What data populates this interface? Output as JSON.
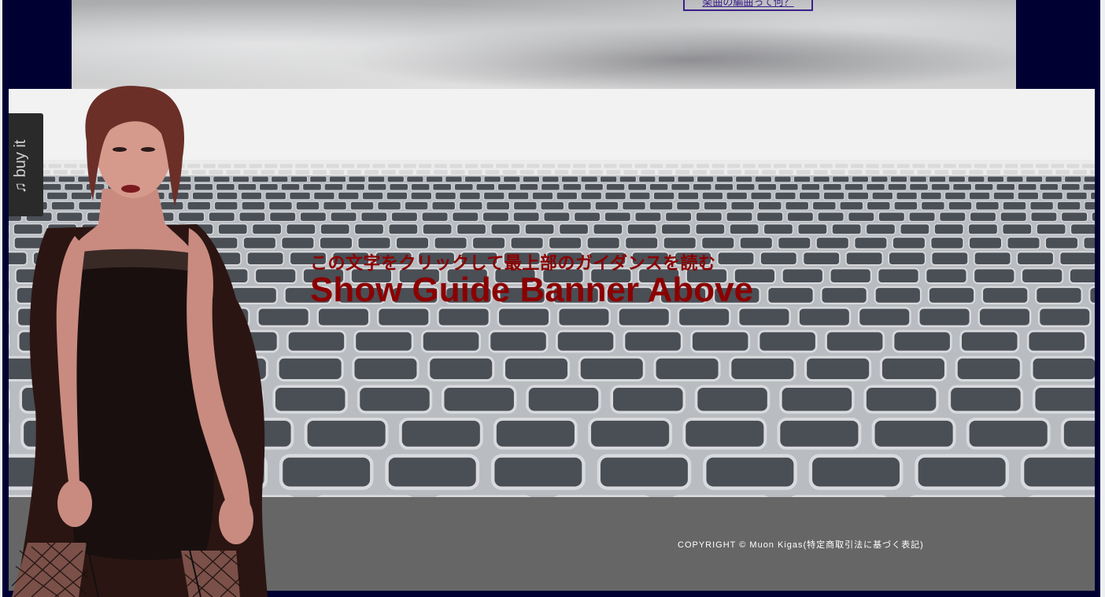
{
  "top_banner": {
    "link_label": "楽曲の編曲って何？"
  },
  "buy_tab": {
    "label": "buy it",
    "icon": "music-note-icon"
  },
  "main": {
    "jp_heading": "この文字をクリックして最上部のガイダンスを読む",
    "en_heading": "Show Guide Banner Above"
  },
  "footer": {
    "copyright": "COPYRIGHT © Muon Kigas(特定商取引法に基づく表記)"
  },
  "colors": {
    "background": "#000033",
    "heading": "#8b0000",
    "footer": "#666666",
    "link": "#3b1f8a"
  }
}
